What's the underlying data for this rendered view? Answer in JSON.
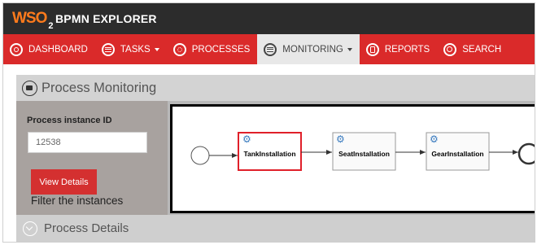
{
  "brand": {
    "logo_text": "WSO",
    "logo_sub": "2",
    "title": "BPMN EXPLORER",
    "accent": "#ff7b1c"
  },
  "nav": {
    "color": "#da2a2a",
    "items": [
      {
        "label": "DASHBOARD",
        "icon": "dashboard-icon",
        "dropdown": false,
        "active": false
      },
      {
        "label": "TASKS",
        "icon": "list-icon",
        "dropdown": true,
        "active": false
      },
      {
        "label": "PROCESSES",
        "icon": "processes-icon",
        "dropdown": false,
        "active": false
      },
      {
        "label": "MONITORING",
        "icon": "list-icon",
        "dropdown": true,
        "active": true
      },
      {
        "label": "REPORTS",
        "icon": "report-icon",
        "dropdown": false,
        "active": false
      },
      {
        "label": "SEARCH",
        "icon": "search-icon",
        "dropdown": false,
        "active": false
      }
    ]
  },
  "monitoring": {
    "title": "Process Monitoring",
    "process_instance_label": "Process instance ID",
    "process_instance_value": "12538",
    "view_details_label": "View Details",
    "filter_label": "Filter the instances"
  },
  "diagram": {
    "tasks": [
      {
        "label": "TankInstallation",
        "highlighted": true
      },
      {
        "label": "SeatInstallation",
        "highlighted": false
      },
      {
        "label": "GearInstallation",
        "highlighted": false
      }
    ],
    "highlight_color": "#e0202a"
  },
  "details": {
    "title": "Process Details"
  }
}
